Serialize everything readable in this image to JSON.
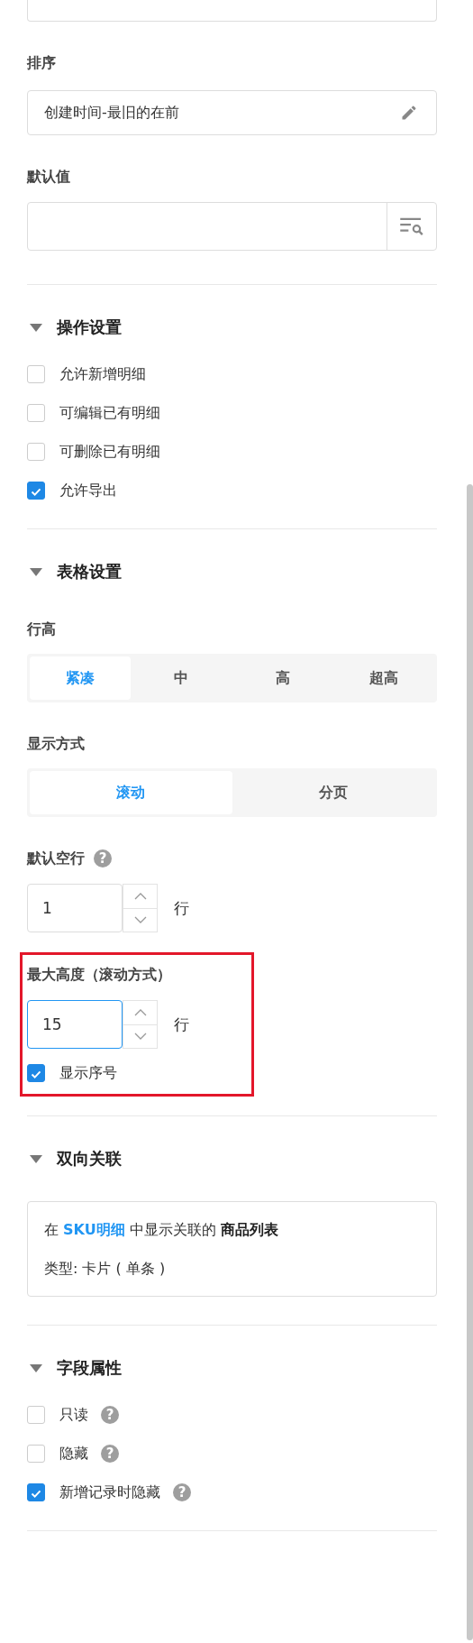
{
  "sort": {
    "label": "排序",
    "value": "创建时间-最旧的在前"
  },
  "default_value": {
    "label": "默认值"
  },
  "sections": [
    {
      "kind": "checks",
      "title": "操作设置",
      "expanded": true,
      "items": [
        {
          "label": "允许新增明细",
          "checked": false
        },
        {
          "label": "可编辑已有明细",
          "checked": false
        },
        {
          "label": "可删除已有明细",
          "checked": false
        },
        {
          "label": "允许导出",
          "checked": true
        }
      ]
    },
    {
      "kind": "table",
      "title": "表格设置",
      "expanded": true,
      "row_height": {
        "label": "行高",
        "options": [
          {
            "label": "紧凑",
            "selected": true
          },
          {
            "label": "中",
            "selected": false
          },
          {
            "label": "高",
            "selected": false
          },
          {
            "label": "超高",
            "selected": false
          }
        ]
      },
      "display_mode": {
        "label": "显示方式",
        "options": [
          {
            "label": "滚动",
            "selected": true
          },
          {
            "label": "分页",
            "selected": false
          }
        ]
      },
      "default_blank_rows": {
        "label": "默认空行",
        "help": "?",
        "value": "1",
        "unit": "行",
        "focused": false
      },
      "max_height": {
        "label": "最大高度（滚动方式）",
        "value": "15",
        "unit": "行",
        "focused": true,
        "highlighted": true
      },
      "show_index": {
        "label": "显示序号",
        "checked": true
      }
    },
    {
      "kind": "relation",
      "title": "双向关联",
      "expanded": true,
      "line": "在 **SKU明细** 中显示关联的 **商品列表**",
      "type_text": "类型: 卡片 ( 单条 )"
    },
    {
      "kind": "checks",
      "title": "字段属性",
      "expanded": true,
      "items": [
        {
          "label": "只读",
          "checked": false,
          "help": "?"
        },
        {
          "label": "隐藏",
          "checked": false,
          "help": "?"
        },
        {
          "label": "新增记录时隐藏",
          "checked": true,
          "help": "?"
        }
      ]
    }
  ]
}
